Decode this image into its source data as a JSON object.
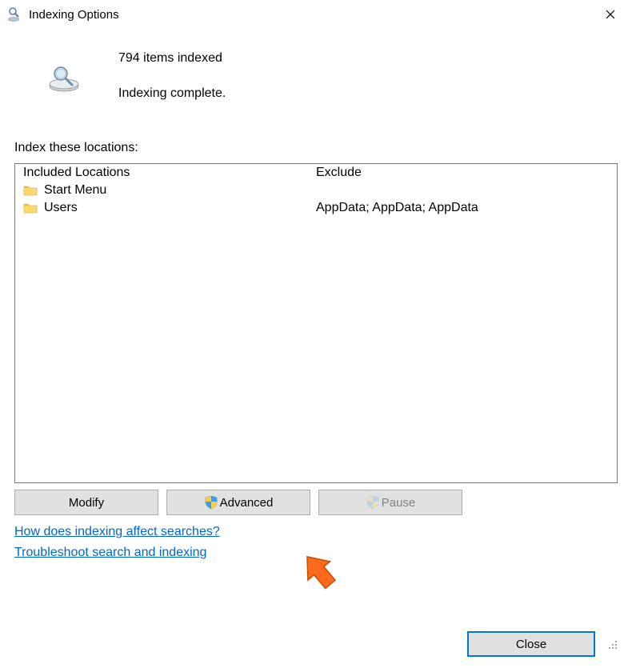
{
  "titlebar": {
    "title": "Indexing Options"
  },
  "status": {
    "count_text": "794 items indexed",
    "complete_text": "Indexing complete."
  },
  "section": {
    "label": "Index these locations:"
  },
  "table": {
    "headers": {
      "included": "Included Locations",
      "exclude": "Exclude"
    },
    "rows": [
      {
        "included": "Start Menu",
        "exclude": ""
      },
      {
        "included": "Users",
        "exclude": "AppData; AppData; AppData"
      }
    ]
  },
  "buttons": {
    "modify": "Modify",
    "advanced": "Advanced",
    "pause": "Pause",
    "close": "Close"
  },
  "links": {
    "how": "How does indexing affect searches?",
    "troubleshoot": "Troubleshoot search and indexing"
  }
}
